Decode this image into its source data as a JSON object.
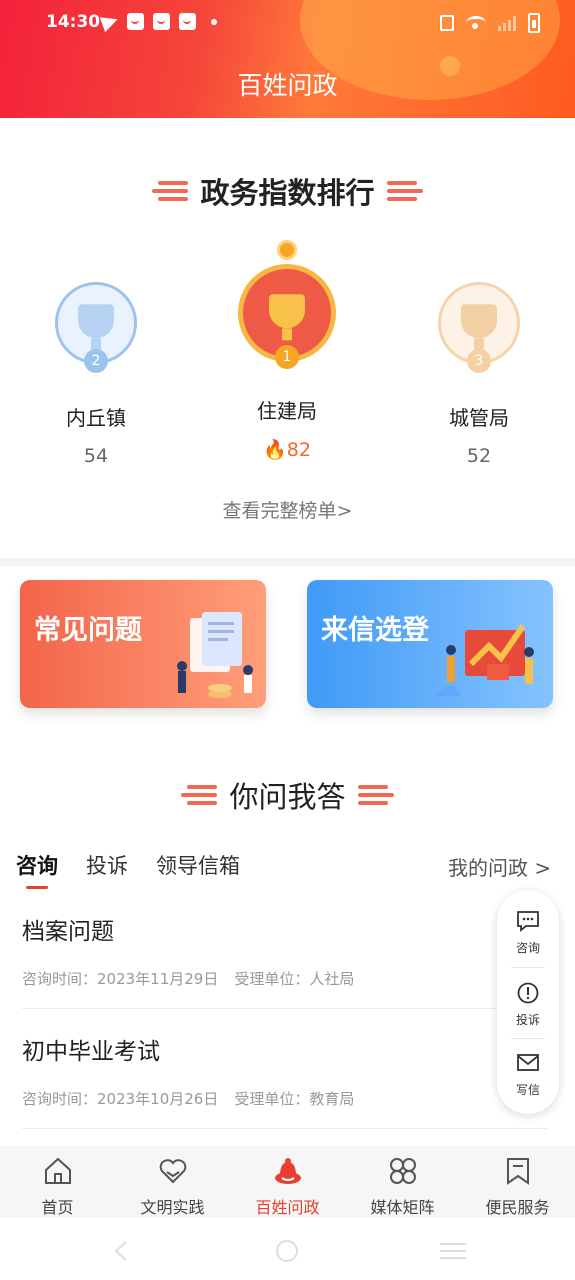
{
  "status": {
    "time": "14:30"
  },
  "header": {
    "title": "百姓问政"
  },
  "ranking": {
    "title": "政务指数排行",
    "items": [
      {
        "rank": "2",
        "name": "内丘镇",
        "score": "54"
      },
      {
        "rank": "1",
        "name": "住建局",
        "score": "82"
      },
      {
        "rank": "3",
        "name": "城管局",
        "score": "52"
      }
    ],
    "more": "查看完整榜单>"
  },
  "cards": [
    {
      "label": "常见问题"
    },
    {
      "label": "来信选登"
    }
  ],
  "qa": {
    "title": "你问我答",
    "tabs": [
      "咨询",
      "投诉",
      "领导信箱"
    ],
    "my_link": "我的问政 >",
    "items": [
      {
        "title": "档案问题",
        "time": "咨询时间：2023年11月29日",
        "unit": "受理单位：人社局"
      },
      {
        "title": "初中毕业考试",
        "time": "咨询时间：2023年10月26日",
        "unit": "受理单位：教育局"
      }
    ]
  },
  "float_menu": [
    "咨询",
    "投诉",
    "写信"
  ],
  "nav": [
    "首页",
    "文明实践",
    "百姓问政",
    "媒体矩阵",
    "便民服务"
  ],
  "colors": {
    "accent": "#e8402f",
    "gold": "#f5a623"
  }
}
